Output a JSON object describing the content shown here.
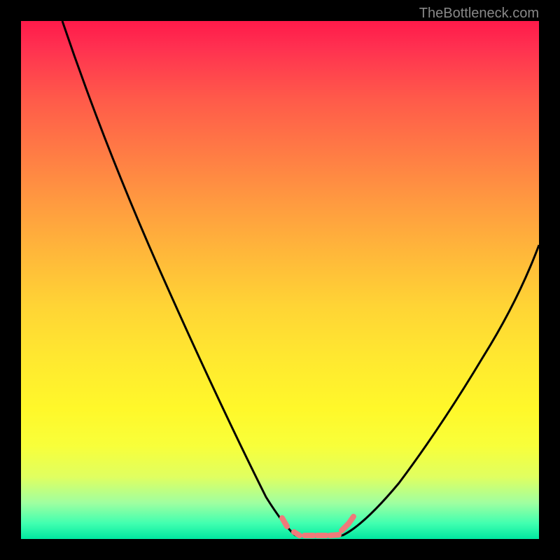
{
  "watermark": "TheBottleneck.com",
  "chart_data": {
    "type": "line",
    "title": "",
    "xlabel": "",
    "ylabel": "",
    "xlim": [
      0,
      100
    ],
    "ylim": [
      0,
      100
    ],
    "background_gradient": {
      "top": "#ff1a4a",
      "mid": "#ffe830",
      "bottom": "#00e8a0"
    },
    "series": [
      {
        "name": "left-curve",
        "color": "#000000",
        "x": [
          8,
          15,
          22,
          30,
          38,
          45,
          50,
          53
        ],
        "y": [
          100,
          82,
          64,
          46,
          28,
          12,
          3,
          0
        ]
      },
      {
        "name": "right-curve",
        "color": "#000000",
        "x": [
          62,
          66,
          72,
          80,
          88,
          96,
          100
        ],
        "y": [
          0,
          3,
          10,
          22,
          36,
          50,
          58
        ]
      },
      {
        "name": "bottom-flat",
        "color": "#000000",
        "x": [
          53,
          62
        ],
        "y": [
          0,
          0
        ]
      },
      {
        "name": "pink-markers",
        "color": "#ef7a7a",
        "type": "scatter",
        "x": [
          50,
          53,
          55,
          57,
          59,
          61,
          62,
          63
        ],
        "y": [
          3,
          0,
          0,
          0,
          0,
          0,
          2,
          4
        ]
      }
    ]
  }
}
